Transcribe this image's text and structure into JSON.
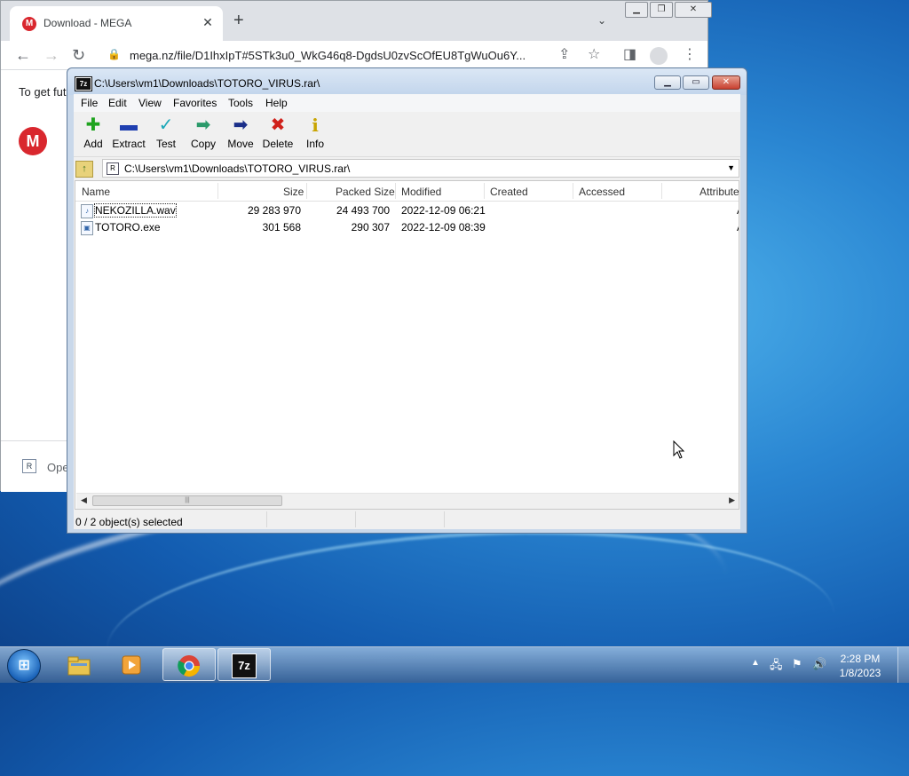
{
  "chrome": {
    "tab_title": "Download - MEGA",
    "tab_favicon": "M",
    "url": "mega.nz/file/D1IhxIpT#5STk3u0_WkG46q8-DgdsU0zvScOfEU8TgWuOu6Y...",
    "page_text": "To get fut",
    "mega_logo": "M",
    "bottom_text": "Ope"
  },
  "zip": {
    "title": "C:\\Users\\vm1\\Downloads\\TOTORO_VIRUS.rar\\",
    "menu": [
      "File",
      "Edit",
      "View",
      "Favorites",
      "Tools",
      "Help"
    ],
    "toolbar": [
      {
        "label": "Add",
        "icon": "add-icon",
        "glyph": "✚",
        "color": "#1fa31f"
      },
      {
        "label": "Extract",
        "icon": "extract-icon",
        "glyph": "▬",
        "color": "#1f3fb0"
      },
      {
        "label": "Test",
        "icon": "test-icon",
        "glyph": "✓",
        "color": "#1aa7b8"
      },
      {
        "label": "Copy",
        "icon": "copy-icon",
        "glyph": "➡",
        "color": "#2a9a6a"
      },
      {
        "label": "Move",
        "icon": "move-icon",
        "glyph": "➡",
        "color": "#1b2f8a"
      },
      {
        "label": "Delete",
        "icon": "delete-icon",
        "glyph": "✖",
        "color": "#d0201a"
      },
      {
        "label": "Info",
        "icon": "info-icon",
        "glyph": "i",
        "color": "#c9a400"
      }
    ],
    "address": "C:\\Users\\vm1\\Downloads\\TOTORO_VIRUS.rar\\",
    "columns": [
      "Name",
      "Size",
      "Packed Size",
      "Modified",
      "Created",
      "Accessed",
      "Attribute"
    ],
    "files": [
      {
        "name": "NEKOZILLA.wav",
        "size": "29 283 970",
        "packed": "24 493 700",
        "modified": "2022-12-09 06:21",
        "attr": "A"
      },
      {
        "name": "TOTORO.exe",
        "size": "301 568",
        "packed": "290 307",
        "modified": "2022-12-09 08:39",
        "attr": "A"
      }
    ],
    "status": "0 / 2 object(s) selected"
  },
  "taskbar": {
    "start_label": "Start",
    "seven_zip_label": "7z",
    "time": "2:28 PM",
    "date": "1/8/2023"
  }
}
